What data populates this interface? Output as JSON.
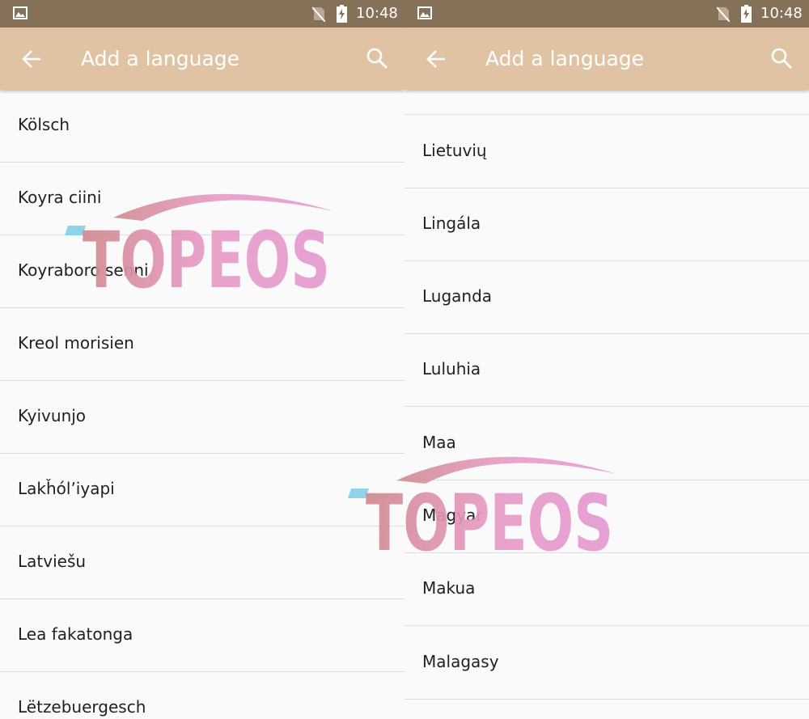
{
  "status_bar": {
    "time": "10:48"
  },
  "app_bar": {
    "title": "Add a language"
  },
  "watermark": "TOPEOS",
  "left_list": [
    "Kölsch",
    "Koyra ciini",
    "Koyraboro senni",
    "Kreol morisien",
    "Kyivunjo",
    "Lakȟólʼiyapi",
    "Latviešu",
    "Lea fakatonga",
    "Lëtzebuergesch"
  ],
  "right_list": [
    "Lietuvių",
    "Lingála",
    "Luganda",
    "Luluhia",
    "Maa",
    "Magyar",
    "Makua",
    "Malagasy"
  ],
  "colors": {
    "status_bar": "#857157",
    "app_bar": "#e0c3a3",
    "background": "#fafafa",
    "divider": "#dedede",
    "text": "#212121"
  },
  "icons": [
    "image-notification-icon",
    "no-sim-icon",
    "battery-charging-icon",
    "back-arrow-icon",
    "search-icon"
  ]
}
